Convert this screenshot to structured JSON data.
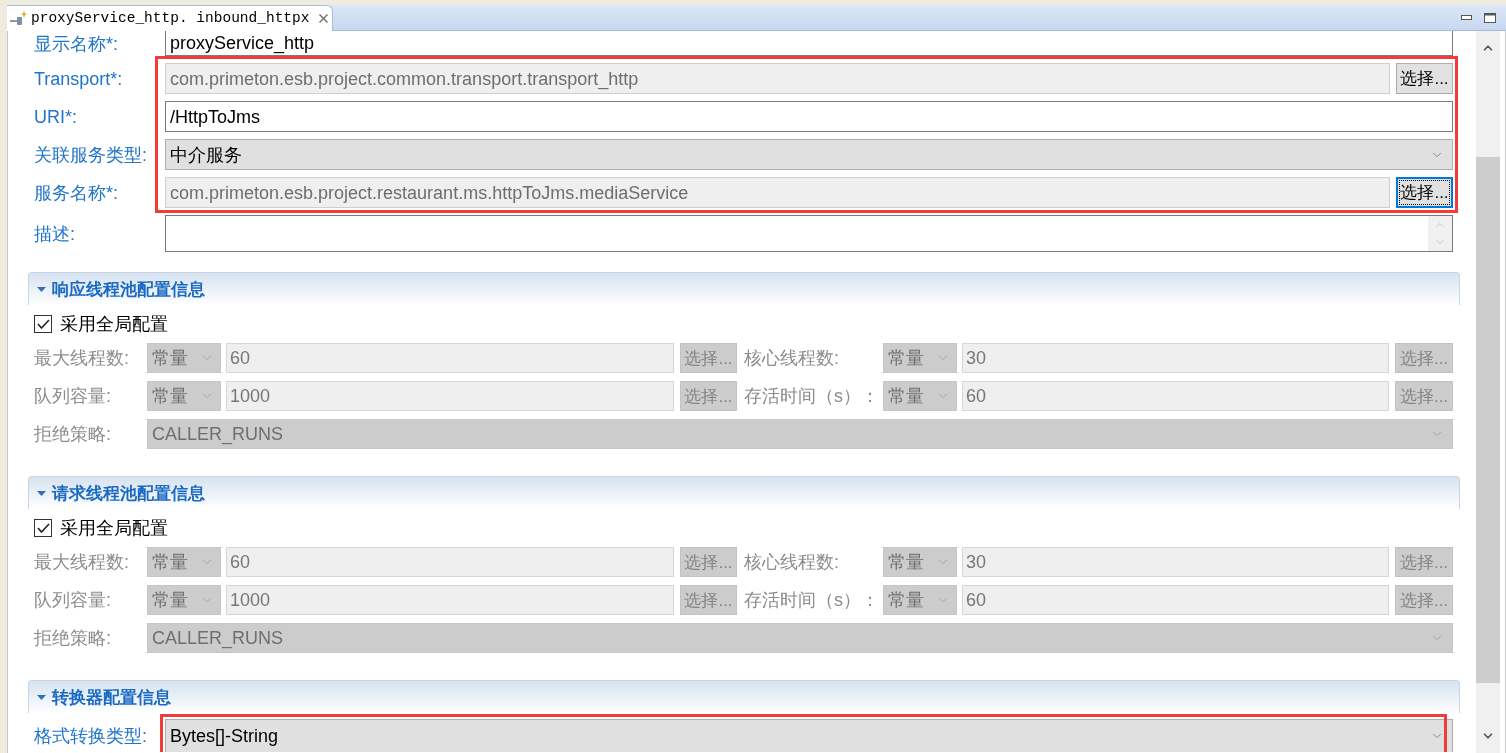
{
  "tab": {
    "title": "proxyService_http. inbound_httpx"
  },
  "form": {
    "groups": [
      {
        "rows": [
          {
            "kind": "text",
            "label": "显示名称*:",
            "value": "proxyService_http",
            "readonly": false
          }
        ]
      },
      {
        "highlighted": true,
        "rows": [
          {
            "kind": "text",
            "label": "Transport*:",
            "value": "com.primeton.esb.project.common.transport.transport_http",
            "readonly": true,
            "button": {
              "label": "选择...",
              "focused": false
            }
          },
          {
            "kind": "text",
            "label": "URI*:",
            "value": "/HttpToJms",
            "readonly": false
          },
          {
            "kind": "select",
            "label": "关联服务类型:",
            "value": "中介服务"
          },
          {
            "kind": "text",
            "label": "服务名称*:",
            "value": "com.primeton.esb.project.restaurant.ms.httpToJms.mediaService",
            "readonly": true,
            "button": {
              "label": "选择...",
              "focused": true
            }
          }
        ]
      },
      {
        "rows": [
          {
            "kind": "textarea",
            "label": "描述:"
          }
        ]
      }
    ]
  },
  "sections": [
    {
      "kind": "thread_pool",
      "title": "响应线程池配置信息",
      "expanded": true,
      "disabled": true,
      "use_global": {
        "label": "采用全局配置",
        "checked": true
      },
      "rows": [
        [
          {
            "label": "最大线程数:",
            "mode": "常量",
            "value": "60",
            "button": "选择..."
          },
          {
            "label": "核心线程数:",
            "mode": "常量",
            "value": "30",
            "button": "选择..."
          }
        ],
        [
          {
            "label": "队列容量:",
            "mode": "常量",
            "value": "1000",
            "button": "选择..."
          },
          {
            "label": "存活时间（s）：",
            "mode": "常量",
            "value": "60",
            "button": "选择..."
          }
        ]
      ],
      "policy": {
        "label": "拒绝策略:",
        "value": "CALLER_RUNS"
      }
    },
    {
      "kind": "thread_pool",
      "title": "请求线程池配置信息",
      "expanded": true,
      "disabled": true,
      "use_global": {
        "label": "采用全局配置",
        "checked": true
      },
      "rows": [
        [
          {
            "label": "最大线程数:",
            "mode": "常量",
            "value": "60",
            "button": "选择..."
          },
          {
            "label": "核心线程数:",
            "mode": "常量",
            "value": "30",
            "button": "选择..."
          }
        ],
        [
          {
            "label": "队列容量:",
            "mode": "常量",
            "value": "1000",
            "button": "选择..."
          },
          {
            "label": "存活时间（s）：",
            "mode": "常量",
            "value": "60",
            "button": "选择..."
          }
        ]
      ],
      "policy": {
        "label": "拒绝策略:",
        "value": "CALLER_RUNS"
      }
    },
    {
      "kind": "converter",
      "title": "转换器配置信息",
      "expanded": true,
      "highlighted": true,
      "field": {
        "label": "格式转换类型:",
        "value": "Bytes[]-String"
      }
    }
  ]
}
